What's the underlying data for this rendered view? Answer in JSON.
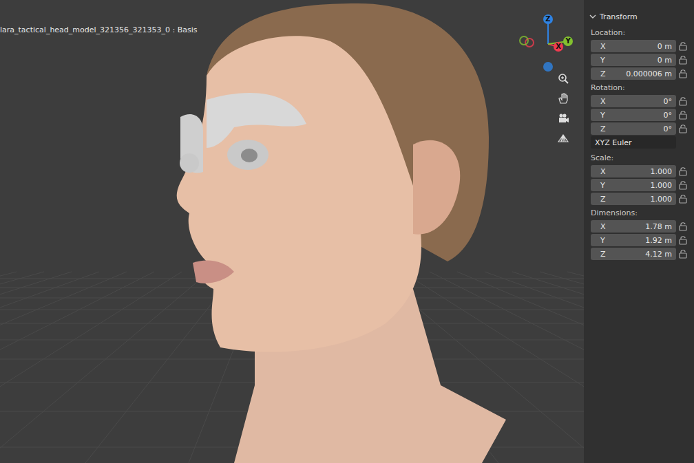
{
  "viewport": {
    "object_label": "lara_tactical_head_model_321356_321353_0 : Basis",
    "gizmo": [
      {
        "axis": "Z",
        "color": "#2f83e3"
      },
      {
        "axis": "X",
        "color": "#ee3b4f"
      },
      {
        "axis": "Y",
        "color": "#83c12f"
      }
    ]
  },
  "transform": {
    "title": "Transform",
    "expanded": true,
    "sections": [
      {
        "label": "Location:",
        "fields": [
          {
            "axis": "X",
            "value": "0 m"
          },
          {
            "axis": "Y",
            "value": "0 m"
          },
          {
            "axis": "Z",
            "value": "0.000006 m"
          }
        ]
      },
      {
        "label": "Rotation:",
        "fields": [
          {
            "axis": "X",
            "value": "0°"
          },
          {
            "axis": "Y",
            "value": "0°"
          },
          {
            "axis": "Z",
            "value": "0°"
          }
        ],
        "mode": "XYZ Euler"
      },
      {
        "label": "Scale:",
        "fields": [
          {
            "axis": "X",
            "value": "1.000"
          },
          {
            "axis": "Y",
            "value": "1.000"
          },
          {
            "axis": "Z",
            "value": "1.000"
          }
        ]
      },
      {
        "label": "Dimensions:",
        "fields": [
          {
            "axis": "X",
            "value": "1.78 m"
          },
          {
            "axis": "Y",
            "value": "1.92 m"
          },
          {
            "axis": "Z",
            "value": "4.12 m"
          }
        ]
      }
    ]
  }
}
